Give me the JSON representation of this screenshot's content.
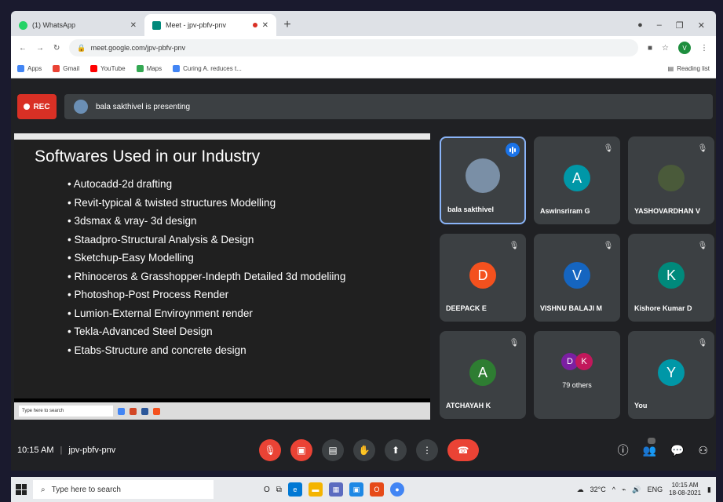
{
  "browser": {
    "tabs": [
      {
        "title": "(1) WhatsApp",
        "icon": "whatsapp-icon",
        "color": "#25d366"
      },
      {
        "title": "Meet - jpv-pbfv-pnv",
        "icon": "meet-icon",
        "color": "#00897b"
      }
    ],
    "url": "meet.google.com/jpv-pbfv-pnv",
    "profile_initial": "V",
    "bookmarks": [
      {
        "label": "Apps",
        "icon": "apps-grid-icon",
        "color": "#4285f4"
      },
      {
        "label": "Gmail",
        "icon": "gmail-icon",
        "color": "#ea4335"
      },
      {
        "label": "YouTube",
        "icon": "youtube-icon",
        "color": "#ff0000"
      },
      {
        "label": "Maps",
        "icon": "maps-icon",
        "color": "#34a853"
      },
      {
        "label": "Curing A. reduces t...",
        "icon": "google-icon",
        "color": "#4285f4"
      }
    ],
    "reading_list": "Reading list"
  },
  "meet": {
    "rec_label": "REC",
    "presenting": "bala sakthivel is presenting",
    "slide": {
      "title": "Softwares Used in our Industry",
      "items": [
        "Autocadd-2d drafting",
        "Revit-typical & twisted structures Modelling",
        "3dsmax & vray- 3d design",
        "Staadpro-Structural Analysis & Design",
        "Sketchup-Easy Modelling",
        "Rhinoceros & Grasshopper-Indepth Detailed 3d modeliing",
        "Photoshop-Post Process Render",
        "Lumion-External Enviroynment render",
        "Tekla-Advanced Steel Design",
        "Etabs-Structure and concrete design"
      ],
      "taskbar_search": "Type here to search"
    },
    "participants": [
      {
        "name": "bala sakthivel",
        "initial": "",
        "color": "#7a8fa6",
        "speaking": true
      },
      {
        "name": "Aswinsriram G",
        "initial": "A",
        "color": "#0097a7"
      },
      {
        "name": "YASHOVARDHAN V",
        "initial": "",
        "color": "#4a5a3a"
      },
      {
        "name": "DEEPACK E",
        "initial": "D",
        "color": "#f4511e"
      },
      {
        "name": "VISHNU BALAJI M",
        "initial": "V",
        "color": "#1565c0"
      },
      {
        "name": "Kishore Kumar D",
        "initial": "K",
        "color": "#00897b"
      },
      {
        "name": "ATCHAYAH K",
        "initial": "A",
        "color": "#2e7d32"
      },
      {
        "name": "79 others",
        "initials": [
          "D",
          "K"
        ],
        "colors": [
          "#7b1fa2",
          "#c2185b"
        ]
      },
      {
        "name": "You",
        "initial": "Y",
        "color": "#0097a7"
      }
    ],
    "time": "10:15 AM",
    "meeting_code": "jpv-pbfv-pnv"
  },
  "taskbar": {
    "search_placeholder": "Type here to search",
    "temp": "32°C",
    "lang": "ENG",
    "time": "10:15 AM",
    "date": "18-08-2021"
  }
}
